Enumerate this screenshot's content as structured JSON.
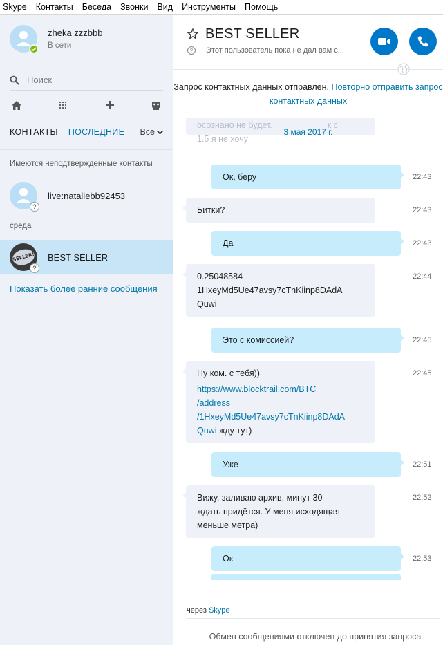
{
  "menu": [
    "Skype",
    "Контакты",
    "Беседа",
    "Звонки",
    "Вид",
    "Инструменты",
    "Помощь"
  ],
  "profile": {
    "name": "zheka zzzbbb",
    "status": "В сети"
  },
  "search": {
    "placeholder": "Поиск"
  },
  "toolbar": {
    "icons": [
      "home-icon",
      "dialpad-icon",
      "add-icon",
      "bot-icon"
    ]
  },
  "tabs": {
    "contacts": "КОНТАКТЫ",
    "recent": "ПОСЛЕДНИЕ",
    "filter": "Все"
  },
  "sidebar": {
    "pending_label": "Имеются неподтвержденные контакты",
    "pending_contact": "live:nataliebb92453",
    "day_label": "среда",
    "selected_contact": "BEST SELLER",
    "badge_text": "BEST SELLER!",
    "show_earlier": "Показать более ранние сообщения"
  },
  "chat": {
    "title": "BEST SELLER",
    "subtitle": "Этот пользователь пока не дал вам с...",
    "notice_text": "Запрос контактных данных отправлен.",
    "notice_link": "Повторно отправить запрос контактных данных",
    "date_separator": "3 мая 2017 г.",
    "faded_line1": "осознано не будет.",
    "faded_line2": "1.5 я не хочу",
    "faded_line3": "к с",
    "messages": [
      {
        "dir": "out",
        "text": "Ок, беру",
        "time": "22:43"
      },
      {
        "dir": "in",
        "text": "Битки?",
        "time": "22:43"
      },
      {
        "dir": "out",
        "text": "Да",
        "time": "22:43"
      },
      {
        "dir": "in",
        "line1": "0.25048584",
        "line2": "1HxeyMd5Ue47avsy7cTnKiinp8DAdA",
        "line3": "Quwi",
        "time": "22:44"
      },
      {
        "dir": "out",
        "text": "Это с комиссией?",
        "time": "22:45"
      },
      {
        "dir": "in",
        "line1": "Ну ком. с тебя))",
        "link1": "https://www.blocktrail.com/BTC",
        "link2": "/address",
        "link3": "/1HxeyMd5Ue47avsy7cTnKiinp8DAdA",
        "link4": "Quwi",
        "tail": " жду тут)",
        "time": "22:45"
      },
      {
        "dir": "out",
        "text": "Уже",
        "time": "22:51"
      },
      {
        "dir": "in",
        "line1": "Вижу, заливаю архив, минут 30",
        "line2": "ждать придётся. У меня исходящая",
        "line3": "меньше метра)",
        "time": "22:52"
      },
      {
        "dir": "out",
        "text": "Ок",
        "time": "22:53"
      }
    ],
    "via_prefix": "через",
    "via_link": "Skype",
    "disabled_text": "Обмен сообщениями отключен до принятия запроса"
  },
  "colors": {
    "accent": "#0078ca",
    "link": "#0078a8",
    "sidebar_bg": "#eef1f7",
    "selected": "#c7e5f7",
    "bubble_out": "#c7ecfc",
    "bubble_in": "#eef1f7",
    "online": "#7fba00"
  }
}
